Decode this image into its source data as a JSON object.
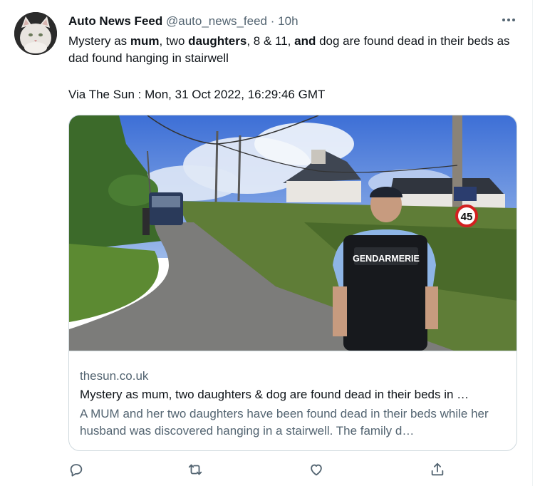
{
  "tweet": {
    "author_name": "Auto News Feed",
    "author_handle": "@auto_news_feed",
    "separator": "·",
    "time": "10h",
    "text_parts": [
      {
        "t": "Mystery as ",
        "b": false
      },
      {
        "t": "mum",
        "b": true
      },
      {
        "t": ", two ",
        "b": false
      },
      {
        "t": "daughters",
        "b": true
      },
      {
        "t": ", 8 & 11, ",
        "b": false
      },
      {
        "t": "and",
        "b": true
      },
      {
        "t": " dog are found dead in their beds as dad found hanging in stairwell",
        "b": false
      }
    ],
    "via": "Via The Sun : Mon, 31 Oct 2022, 16:29:46 GMT"
  },
  "card": {
    "domain": "thesun.co.uk",
    "title": "Mystery as mum, two daughters & dog are found dead in their beds in …",
    "description": "A MUM and her two daughters have been found dead in their beds while her husband was discovered hanging in a stairwell. The family d…",
    "image": {
      "vest_label": "GENDARMERIE",
      "sign_number": "45"
    }
  },
  "icons": {
    "reply": "reply-icon",
    "retweet": "retweet-icon",
    "like": "like-icon",
    "share": "share-icon",
    "more": "more-icon"
  },
  "colors": {
    "secondary_text": "#536471",
    "border": "#cfd9de"
  }
}
